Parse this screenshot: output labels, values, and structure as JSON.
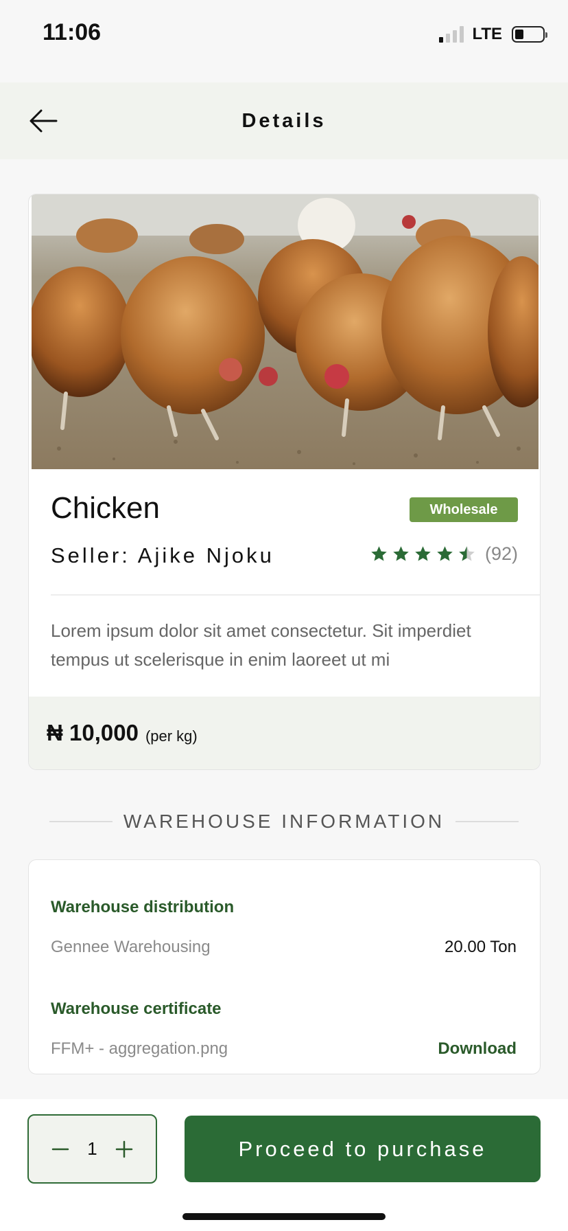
{
  "status_bar": {
    "time": "11:06",
    "network": "LTE",
    "signal_bars_active": 1,
    "battery_level": 0.25
  },
  "header": {
    "title": "Details",
    "back_icon": "arrow-left-icon"
  },
  "product": {
    "name": "Chicken",
    "badge": "Wholesale",
    "seller": "Seller: Ajike Njoku",
    "rating": 4.5,
    "rating_count": "(92)",
    "description": "Lorem ipsum dolor sit amet consectetur. Sit imperdiet tempus ut scelerisque in enim laoreet ut mi",
    "price": "₦ 10,000",
    "price_unit": "(per kg)",
    "image": "chickens-photo"
  },
  "warehouse": {
    "section_title": "WAREHOUSE INFORMATION",
    "distribution_label": "Warehouse distribution",
    "distribution_name": "Gennee Warehousing",
    "distribution_qty": "20.00 Ton",
    "certificate_label": "Warehouse certificate",
    "certificate_file": "FFM+ - aggregation.png",
    "download_label": "Download"
  },
  "purchase": {
    "quantity": "1",
    "button_label": "Proceed to purchase"
  },
  "colors": {
    "brand_green": "#2b6b36",
    "badge_green": "#6e9a47",
    "header_bg": "#f1f3ee",
    "star": "#2b6b36"
  }
}
